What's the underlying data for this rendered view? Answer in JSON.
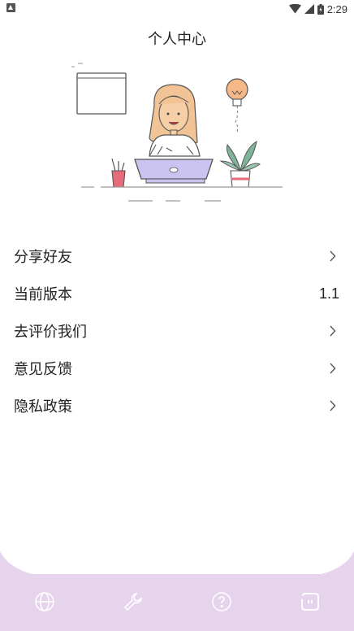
{
  "status_bar": {
    "time": "2:29"
  },
  "header": {
    "title": "个人中心"
  },
  "menu": {
    "share": "分享好友",
    "version_label": "当前版本",
    "version_value": "1.1",
    "rate": "去评价我们",
    "feedback": "意见反馈",
    "privacy": "隐私政策"
  },
  "bottom_nav": {
    "items": [
      "globe-icon",
      "wrench-icon",
      "help-icon",
      "profile-icon"
    ],
    "active": "profile-icon"
  },
  "colors": {
    "accent": "#e6d4ec",
    "nav_icon": "#ffffff",
    "text": "#222222"
  }
}
